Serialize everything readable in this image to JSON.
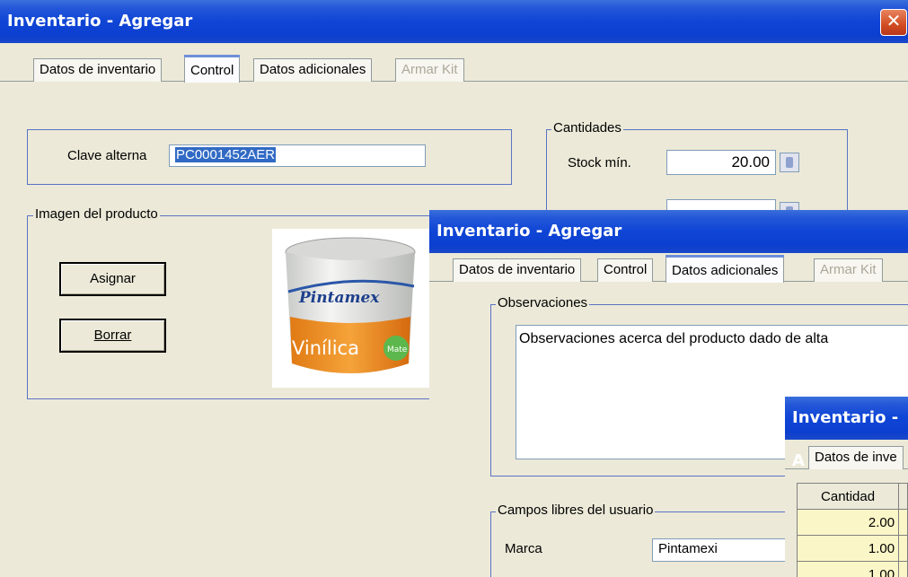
{
  "window1": {
    "title": "Inventario - Agregar",
    "tabs": [
      "Datos de inventario",
      "Control",
      "Datos adicionales",
      "Armar Kit"
    ],
    "clave_alterna_label": "Clave alterna",
    "clave_alterna_value": "PC0001452AER",
    "cantidades_legend": "Cantidades",
    "stock_min_label": "Stock mín.",
    "stock_min_value": "20.00",
    "imagen_legend": "Imagen del producto",
    "asignar_label": "Asignar",
    "borrar_label": "Borrar",
    "product_image": {
      "brand": "Pintamex",
      "sub": "Vinílica",
      "badge": "Mate"
    }
  },
  "window2": {
    "title": "Inventario - Agregar",
    "tabs": [
      "Datos de inventario",
      "Control",
      "Datos adicionales",
      "Armar Kit"
    ],
    "observaciones_legend": "Observaciones",
    "observaciones_value": "Observaciones acerca del producto dado de alta",
    "campos_legend": "Campos libres del usuario",
    "marca_label": "Marca",
    "marca_value": "Pintamexi"
  },
  "window3": {
    "title": "Inventario - A",
    "tab": "Datos de inve",
    "table_header": "Cantidad",
    "rows": [
      "2.00",
      "1.00",
      "1.00"
    ]
  },
  "colors": {
    "title_blue": "#0c3fcf",
    "window_bg": "#ece9d8",
    "selection": "#316ac5",
    "grid_yellow": "#fbf6c7",
    "close_red": "#d24c22"
  }
}
